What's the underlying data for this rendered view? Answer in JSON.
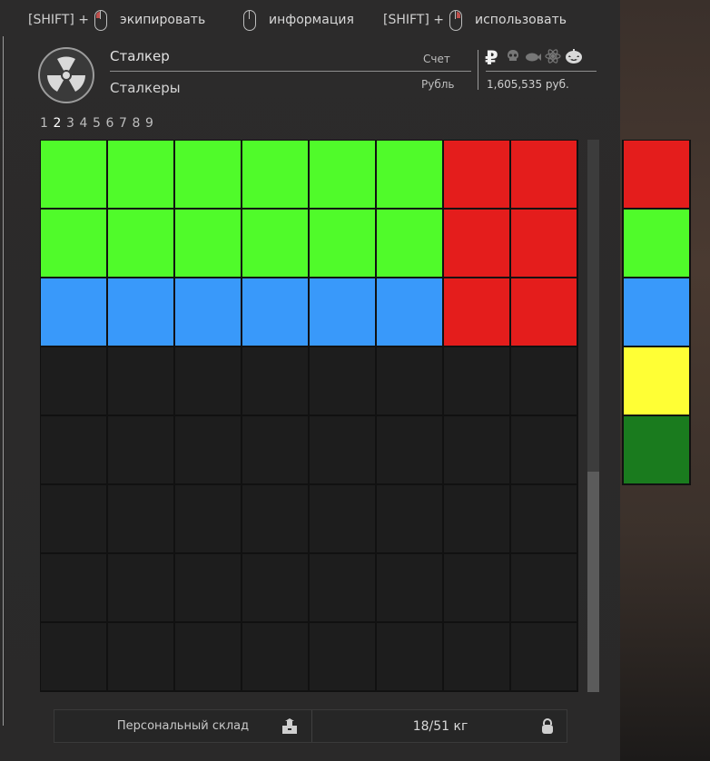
{
  "hints": [
    {
      "shift": "[SHIFT] +",
      "label": "экипировать"
    },
    {
      "shift": "",
      "label": "информация"
    },
    {
      "shift": "[SHIFT] +",
      "label": "использовать"
    }
  ],
  "header": {
    "player_name": "Сталкер",
    "faction": "Сталкеры",
    "account_label": "Счет",
    "currency_label": "Рубль",
    "balance": "1,605,535 руб.",
    "currency_icons": [
      "ruble-icon",
      "skull-icon",
      "fish-icon",
      "atom-icon",
      "pumpkin-icon"
    ],
    "ruble_symbol": "₽"
  },
  "pages": [
    "1",
    "2",
    "3",
    "4",
    "5",
    "6",
    "7",
    "8",
    "9"
  ],
  "current_page": "2",
  "colors": {
    "green": "#50fb2a",
    "blue": "#3999fa",
    "red": "#e41d1c",
    "yellow": "#ffff35",
    "dark_green": "#1a7b1e",
    "empty": "#1d1d1d"
  },
  "grid": {
    "rows": [
      [
        "green",
        "green",
        "green",
        "green",
        "green",
        "green",
        "red",
        "red"
      ],
      [
        "green",
        "green",
        "green",
        "green",
        "green",
        "green",
        "red",
        "red"
      ],
      [
        "blue",
        "blue",
        "blue",
        "blue",
        "blue",
        "blue",
        "red",
        "red"
      ],
      [
        "empty",
        "empty",
        "empty",
        "empty",
        "empty",
        "empty",
        "empty",
        "empty"
      ],
      [
        "empty",
        "empty",
        "empty",
        "empty",
        "empty",
        "empty",
        "empty",
        "empty"
      ],
      [
        "empty",
        "empty",
        "empty",
        "empty",
        "empty",
        "empty",
        "empty",
        "empty"
      ],
      [
        "empty",
        "empty",
        "empty",
        "empty",
        "empty",
        "empty",
        "empty",
        "empty"
      ],
      [
        "empty",
        "empty",
        "empty",
        "empty",
        "empty",
        "empty",
        "empty",
        "empty"
      ]
    ]
  },
  "side_slots": [
    "red",
    "green",
    "blue",
    "yellow",
    "dark_green"
  ],
  "footer": {
    "stash_label": "Персональный склад",
    "weight": "18/51 кг"
  }
}
